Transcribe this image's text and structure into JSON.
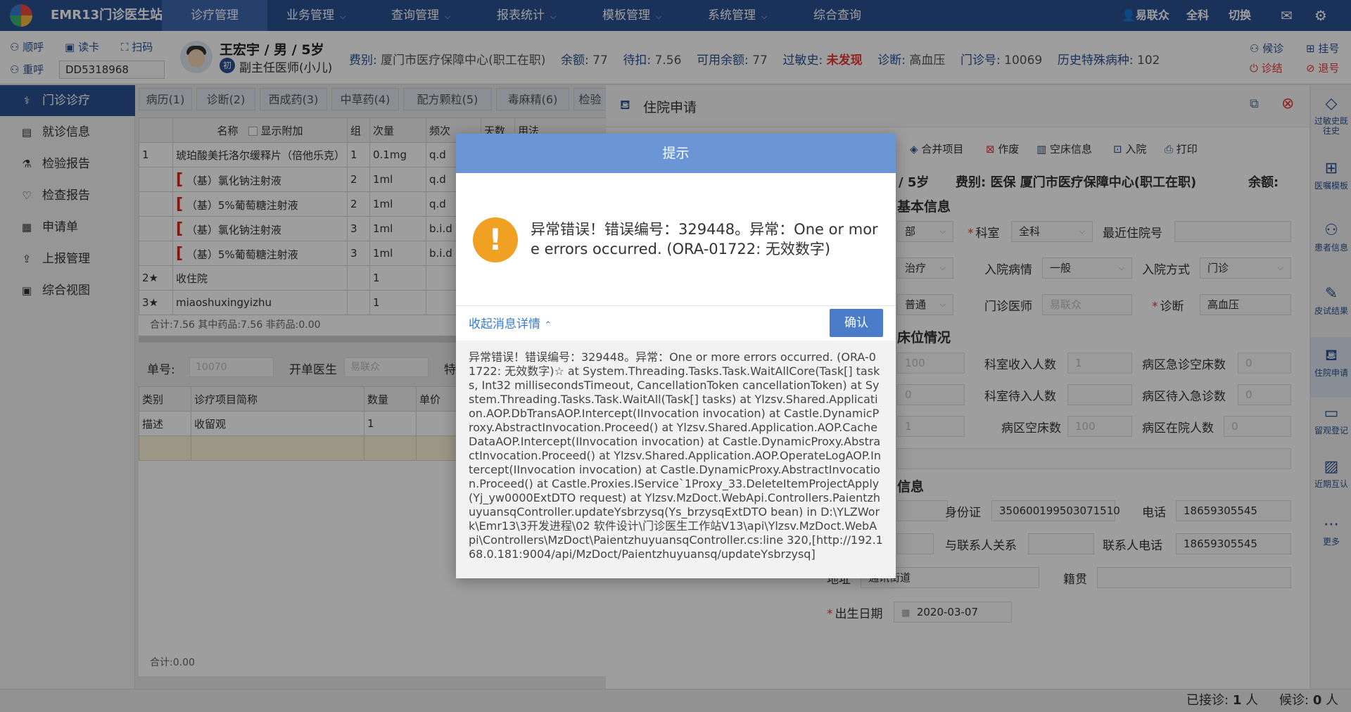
{
  "app": {
    "brand": "EMR13门诊医生站",
    "nav": [
      "诊疗管理",
      "业务管理",
      "查询管理",
      "报表统计",
      "模板管理",
      "系统管理",
      "综合查询"
    ],
    "user": "易联众",
    "dept": "全科",
    "switch": "切换"
  },
  "patient_bar": {
    "next": "顺呼",
    "read_card": "读卡",
    "scan": "扫码",
    "recall": "重呼",
    "id": "DD5318968",
    "name_line": "王宏宇 / 男 / 5岁",
    "badge": "初",
    "doctor_title": "副主任医师(小儿)",
    "fee_label": "费别:",
    "fee_value": "厦门市医疗保障中心(职工在职)",
    "balance_label": "余额:",
    "balance_value": "77",
    "pending_label": "待扣:",
    "pending_value": "7.56",
    "avail_label": "可用余额:",
    "avail_value": "77",
    "allergy_label": "过敏史:",
    "allergy_value": "未发现",
    "diag_label": "诊断:",
    "diag_value": "高血压",
    "visit_label": "门诊号:",
    "visit_value": "10069",
    "history_label": "历史特殊病种:",
    "history_value": "102",
    "waiting": "候诊",
    "register": "挂号",
    "end": "诊结",
    "refund": "退号"
  },
  "sidebar": {
    "items": [
      "门诊诊疗",
      "就诊信息",
      "检验报告",
      "检查报告",
      "申请单",
      "上报管理",
      "综合视图"
    ]
  },
  "center": {
    "tabs": [
      "病历(1)",
      "诊断(2)",
      "西成药(3)",
      "中草药(4)",
      "配方颗粒(5)",
      "毒麻精(6)",
      "检验"
    ],
    "headers": [
      "",
      "名称",
      "显示附加",
      "组",
      "次量",
      "频次",
      "天数",
      "用法"
    ],
    "rows": [
      {
        "no": "1",
        "name": "琥珀酸美托洛尔缓释片（倍他乐克）",
        "group": "1",
        "dose": "0.1mg",
        "freq": "q.d"
      },
      {
        "no": "",
        "name": "（基）氯化钠注射液",
        "group": "2",
        "dose": "1ml",
        "freq": "q.d"
      },
      {
        "no": "",
        "name": "（基）5%葡萄糖注射液",
        "group": "2",
        "dose": "1ml",
        "freq": "q.d"
      },
      {
        "no": "",
        "name": "（基）氯化钠注射液",
        "group": "3",
        "dose": "1ml",
        "freq": "b.i.d"
      },
      {
        "no": "",
        "name": "（基）5%葡萄糖注射液",
        "group": "3",
        "dose": "1ml",
        "freq": "b.i.d"
      },
      {
        "no": "2★",
        "name": "收住院",
        "group": "",
        "dose": "1",
        "freq": ""
      },
      {
        "no": "3★",
        "name": "miaoshuxingyizhu",
        "group": "",
        "dose": "1",
        "freq": ""
      }
    ],
    "summary": "合计:7.56   其中药品:7.56   非药品:0.00",
    "order_no_label": "单号:",
    "order_no": "10070",
    "doctor_label": "开单医生",
    "doctor_value": "易联众",
    "special_label": "特",
    "lower_headers": [
      "类别",
      "诊疗项目简称",
      "数量",
      "单价"
    ],
    "lower_rows": [
      {
        "type": "描述",
        "name": "收留观",
        "qty": "1",
        "price": ""
      }
    ],
    "lower_summary": "合计:0.00"
  },
  "right_panel": {
    "title": "住院申请",
    "toolbar": [
      "合并项目",
      "作废",
      "空床信息",
      "入院",
      "打印"
    ],
    "toolbar_partial": "",
    "patient_line": "/ 5岁",
    "fee_label": "费别:",
    "fee_value": "医保 厦门市医疗保障中心(职工在职)",
    "balance_label": "余额:",
    "sec_basic": "基本信息",
    "dept_partial": "部",
    "ward_label": "科室",
    "ward_value": "全科",
    "last_adm_label": "最近住院号",
    "treat_partial": "治疗",
    "cond_label": "入院病情",
    "cond_value": "一般",
    "mode_label": "入院方式",
    "mode_value": "门诊",
    "level_value": "普通",
    "doctor_label": "门诊医师",
    "doctor_value": "易联众",
    "diag_label": "诊断",
    "diag_value": "高血压",
    "sec_bed": "床位情况",
    "bed_a": "100",
    "dept_income_label": "科室收入人数",
    "dept_income_value": "1",
    "ward_er_empty_label": "病区急诊空床数",
    "ward_er_empty_value": "0",
    "bed_b": "0",
    "dept_wait_label": "科室待入人数",
    "dept_wait_value": "",
    "ward_er_wait_label": "病区待入急诊数",
    "ward_er_wait_value": "0",
    "bed_c": "1",
    "ward_empty_label": "病区空床数",
    "ward_empty_value": "100",
    "ward_in_label": "病区在院人数",
    "ward_in_value": "0",
    "sec_info": "信息",
    "idcard_label": "身份证",
    "idcard_value": "350600199503071510",
    "phone_label": "电话",
    "phone_value": "18659305545",
    "rel_label": "与联系人关系",
    "contact_phone_label": "联系人电话",
    "contact_phone_value": "18659305545",
    "addr_label": "地址",
    "addr_value": "通讯街道",
    "native_label": "籍贯",
    "birth_label": "出生日期",
    "birth_value": "2020-03-07"
  },
  "right_toolbar": [
    "过敏史既往史",
    "医嘱模板",
    "患者信息",
    "皮试结果",
    "住院申请",
    "留观登记",
    "近期互认",
    "更多"
  ],
  "statusbar": {
    "seen_label": "已接诊:",
    "seen_value": "1",
    "seen_unit": "人",
    "wait_label": "候诊:",
    "wait_value": "0",
    "wait_unit": "人"
  },
  "modal": {
    "title": "提示",
    "message": "异常错误！错误编号：329448。异常：One or more errors occurred. (ORA-01722: 无效数字)",
    "toggle": "收起消息详情",
    "ok": "确认",
    "detail": "异常错误！错误编号：329448。异常：One or more errors occurred. (ORA-01722: 无效数字)☆ at System.Threading.Tasks.Task.WaitAllCore(Task[] tasks, Int32 millisecondsTimeout, CancellationToken cancellationToken) at System.Threading.Tasks.Task.WaitAll(Task[] tasks) at Ylzsv.Shared.Application.AOP.DbTransAOP.Intercept(IInvocation invocation) at Castle.DynamicProxy.AbstractInvocation.Proceed() at Ylzsv.Shared.Application.AOP.CacheDataAOP.Intercept(IInvocation invocation) at Castle.DynamicProxy.AbstractInvocation.Proceed() at Ylzsv.Shared.Application.AOP.OperateLogAOP.Intercept(IInvocation invocation) at Castle.DynamicProxy.AbstractInvocation.Proceed() at Castle.Proxies.IService`1Proxy_33.DeleteItemProjectApply(Yj_yw0000ExtDTO request) at Ylzsv.MzDoct.WebApi.Controllers.PaientzhuyuansqController.updateYsbrzysq(Ys_brzysqExtDTO bean) in D:\\YLZWork\\Emr13\\3开发进程\\02 软件设计\\门诊医生工作站V13\\api\\Ylzsv.MzDoct.WebApi\\Controllers\\MzDoct\\PaientzhuyuansqController.cs:line 320,[http://192.168.0.181:9004/api/MzDoct/Paientzhuyuansq/updateYsbrzysq]"
  },
  "colors": {
    "nav_bg": "#2b5192",
    "accent": "#4a7cc9",
    "warning": "#f0a022",
    "danger": "#e53935"
  }
}
